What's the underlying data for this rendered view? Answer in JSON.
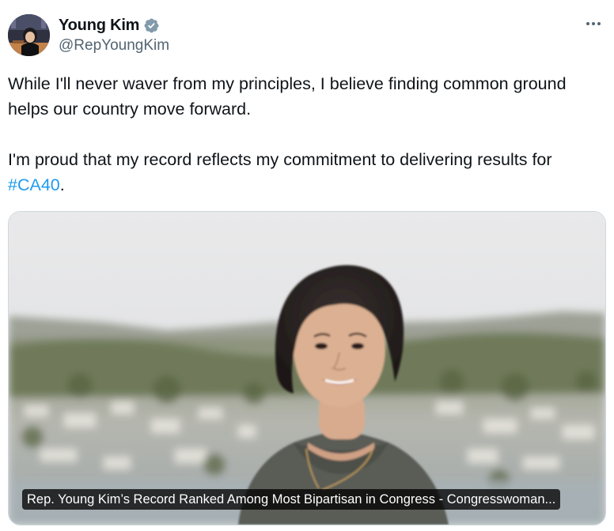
{
  "author": {
    "display_name": "Young Kim",
    "handle": "@RepYoungKim",
    "verified": true,
    "avatar_icon": "profile-photo"
  },
  "menu": {
    "more_icon": "more-horizontal-icon"
  },
  "tweet": {
    "paragraph1": "While I'll never waver from my principles, I believe finding common ground helps our country move forward.",
    "paragraph2_text": "I'm proud that my record reflects my commitment to delivering results for",
    "hashtag": "#CA40",
    "paragraph2_end": "."
  },
  "card": {
    "caption": "Rep. Young Kim’s Record Ranked Among Most Bipartisan in Congress - Congresswoman..."
  },
  "colors": {
    "link": "#1d9bf0",
    "text": "#0f1419",
    "secondary": "#536471",
    "border": "#cfd9de"
  }
}
